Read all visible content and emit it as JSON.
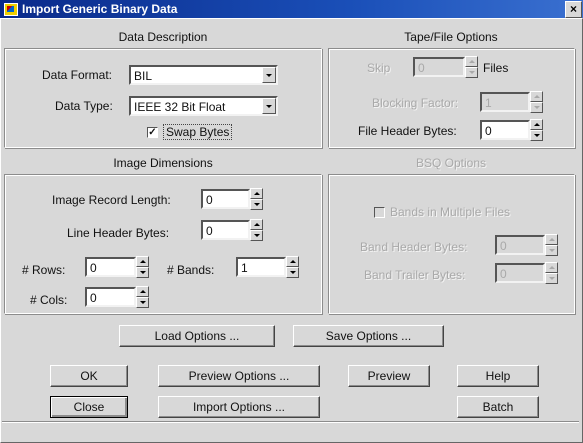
{
  "window": {
    "title": "Import Generic Binary Data",
    "close_glyph": "×"
  },
  "data_description": {
    "title": "Data Description",
    "data_format_label": "Data Format:",
    "data_format_value": "BIL",
    "data_type_label": "Data Type:",
    "data_type_value": "IEEE 32 Bit Float",
    "swap_bytes_label": "Swap Bytes",
    "swap_bytes_checked": true
  },
  "tape_file": {
    "title": "Tape/File Options",
    "skip_label": "Skip",
    "skip_value": "0",
    "files_label": "Files",
    "blocking_label": "Blocking Factor:",
    "blocking_value": "1",
    "header_label": "File Header Bytes:",
    "header_value": "0"
  },
  "image_dimensions": {
    "title": "Image Dimensions",
    "record_length_label": "Image Record Length:",
    "record_length_value": "0",
    "line_header_label": "Line Header Bytes:",
    "line_header_value": "0",
    "rows_label": "# Rows:",
    "rows_value": "0",
    "bands_label": "# Bands:",
    "bands_value": "1",
    "cols_label": "# Cols:",
    "cols_value": "0"
  },
  "bsq": {
    "title": "BSQ Options",
    "multiple_files_label": "Bands in Multiple Files",
    "band_header_label": "Band Header Bytes:",
    "band_header_value": "0",
    "band_trailer_label": "Band Trailer Bytes:",
    "band_trailer_value": "0"
  },
  "buttons": {
    "load_options": "Load Options ...",
    "save_options": "Save Options ...",
    "ok": "OK",
    "preview_options": "Preview Options ...",
    "preview": "Preview",
    "help": "Help",
    "close": "Close",
    "import_options": "Import Options ...",
    "batch": "Batch"
  }
}
